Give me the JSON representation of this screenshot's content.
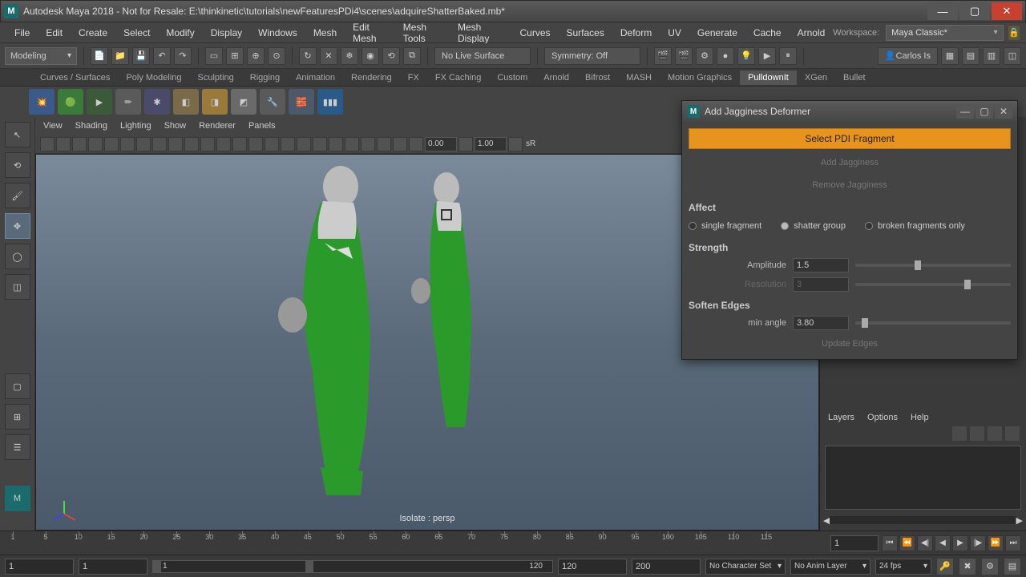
{
  "titlebar": {
    "title": "Autodesk Maya 2018 - Not for Resale: E:\\thinkinetic\\tutorials\\newFeaturesPDi4\\scenes\\adquireShatterBaked.mb*"
  },
  "menu": {
    "items": [
      "File",
      "Edit",
      "Create",
      "Select",
      "Modify",
      "Display",
      "Windows",
      "Mesh",
      "Edit Mesh",
      "Mesh Tools",
      "Mesh Display",
      "Curves",
      "Surfaces",
      "Deform",
      "UV",
      "Generate",
      "Cache",
      "Arnold"
    ],
    "workspace_label": "Workspace:",
    "workspace_value": "Maya Classic*"
  },
  "toolbar": {
    "mode": "Modeling",
    "live_surface": "No Live Surface",
    "symmetry": "Symmetry: Off",
    "user": "Carlos Is"
  },
  "shelf": {
    "tabs": [
      "Curves / Surfaces",
      "Poly Modeling",
      "Sculpting",
      "Rigging",
      "Animation",
      "Rendering",
      "FX",
      "FX Caching",
      "Custom",
      "Arnold",
      "Bifrost",
      "MASH",
      "Motion Graphics",
      "PulldownIt",
      "XGen",
      "Bullet"
    ],
    "active": "PulldownIt"
  },
  "viewport_menu": [
    "View",
    "Shading",
    "Lighting",
    "Show",
    "Renderer",
    "Panels"
  ],
  "viewport_toolbar": {
    "val1": "0.00",
    "val2": "1.00",
    "val3": "sR"
  },
  "viewport_status": "Isolate : persp",
  "dialog": {
    "title": "Add Jagginess Deformer",
    "select_btn": "Select PDI Fragment",
    "add_btn": "Add Jagginess",
    "remove_btn": "Remove Jagginess",
    "affect_label": "Affect",
    "radios": [
      "single fragment",
      "shatter group",
      "broken fragments only"
    ],
    "radio_selected": 1,
    "strength_label": "Strength",
    "amplitude_label": "Amplitude",
    "amplitude_value": "1.5",
    "resolution_label": "Resolution",
    "resolution_value": "3",
    "soften_label": "Soften Edges",
    "minangle_label": "min angle",
    "minangle_value": "3.80",
    "update_btn": "Update Edges"
  },
  "timeline": {
    "ticks": [
      1,
      5,
      10,
      15,
      20,
      25,
      30,
      35,
      40,
      45,
      50,
      55,
      60,
      65,
      70,
      75,
      80,
      85,
      90,
      95,
      100,
      105,
      110,
      115
    ],
    "current": "1"
  },
  "range": {
    "start_outer": "1",
    "start_inner": "1",
    "end_inner": "120",
    "end_outer": "120",
    "end_outer2": "200",
    "no_char": "No Character Set",
    "no_anim": "No Anim Layer",
    "fps": "24 fps"
  },
  "layers": {
    "menu": [
      "Layers",
      "Options",
      "Help"
    ]
  }
}
